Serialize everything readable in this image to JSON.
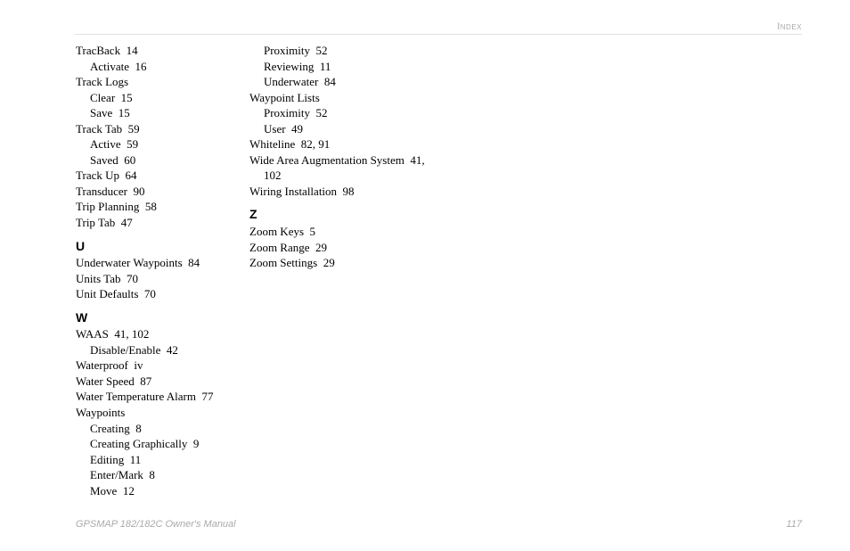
{
  "header": {
    "section_label": "Index"
  },
  "footer": {
    "title": "GPSMAP 182/182C Owner's Manual",
    "page": "117"
  },
  "index": {
    "col1": [
      {
        "type": "entry",
        "term": "TracBack",
        "pages": "14"
      },
      {
        "type": "sub",
        "term": "Activate",
        "pages": "16"
      },
      {
        "type": "entry",
        "term": "Track Logs",
        "pages": ""
      },
      {
        "type": "sub",
        "term": "Clear",
        "pages": "15"
      },
      {
        "type": "sub",
        "term": "Save",
        "pages": "15"
      },
      {
        "type": "entry",
        "term": "Track Tab",
        "pages": "59"
      },
      {
        "type": "sub",
        "term": "Active",
        "pages": "59"
      },
      {
        "type": "sub",
        "term": "Saved",
        "pages": "60"
      },
      {
        "type": "entry",
        "term": "Track Up",
        "pages": "64"
      },
      {
        "type": "entry",
        "term": "Transducer",
        "pages": "90"
      },
      {
        "type": "entry",
        "term": "Trip Planning",
        "pages": "58"
      },
      {
        "type": "entry",
        "term": "Trip Tab",
        "pages": "47"
      },
      {
        "type": "heading",
        "letter": "U"
      },
      {
        "type": "entry",
        "term": "Underwater Waypoints",
        "pages": "84"
      },
      {
        "type": "entry",
        "term": "Units Tab",
        "pages": "70"
      },
      {
        "type": "entry",
        "term": "Unit Defaults",
        "pages": "70"
      },
      {
        "type": "heading",
        "letter": "W"
      },
      {
        "type": "entry",
        "term": "WAAS",
        "pages": "41, 102"
      },
      {
        "type": "sub",
        "term": "Disable/Enable",
        "pages": "42"
      },
      {
        "type": "entry",
        "term": "Waterproof",
        "pages": "iv"
      },
      {
        "type": "entry",
        "term": "Water Speed",
        "pages": "87"
      },
      {
        "type": "entry",
        "term": "Water Temperature Alarm",
        "pages": "77"
      },
      {
        "type": "entry",
        "term": "Waypoints",
        "pages": ""
      },
      {
        "type": "sub",
        "term": "Creating",
        "pages": "8"
      },
      {
        "type": "sub",
        "term": "Creating Graphically",
        "pages": "9"
      },
      {
        "type": "sub",
        "term": "Editing",
        "pages": "11"
      },
      {
        "type": "sub",
        "term": "Enter/Mark",
        "pages": "8"
      },
      {
        "type": "sub",
        "term": "Move",
        "pages": "12"
      }
    ],
    "col2": [
      {
        "type": "sub",
        "term": "Proximity",
        "pages": "52"
      },
      {
        "type": "sub",
        "term": "Reviewing",
        "pages": "11"
      },
      {
        "type": "sub",
        "term": "Underwater",
        "pages": "84"
      },
      {
        "type": "entry",
        "term": "Waypoint Lists",
        "pages": ""
      },
      {
        "type": "sub",
        "term": "Proximity",
        "pages": "52"
      },
      {
        "type": "sub",
        "term": "User",
        "pages": "49"
      },
      {
        "type": "entry",
        "term": "Whiteline",
        "pages": "82, 91"
      },
      {
        "type": "entry",
        "term": "Wide Area Augmentation System",
        "pages": "41,"
      },
      {
        "type": "cont",
        "term": "102",
        "pages": ""
      },
      {
        "type": "entry",
        "term": "Wiring Installation",
        "pages": "98"
      },
      {
        "type": "heading",
        "letter": "Z"
      },
      {
        "type": "entry",
        "term": "Zoom Keys",
        "pages": "5"
      },
      {
        "type": "entry",
        "term": "Zoom Range",
        "pages": "29"
      },
      {
        "type": "entry",
        "term": "Zoom Settings",
        "pages": "29"
      }
    ]
  }
}
